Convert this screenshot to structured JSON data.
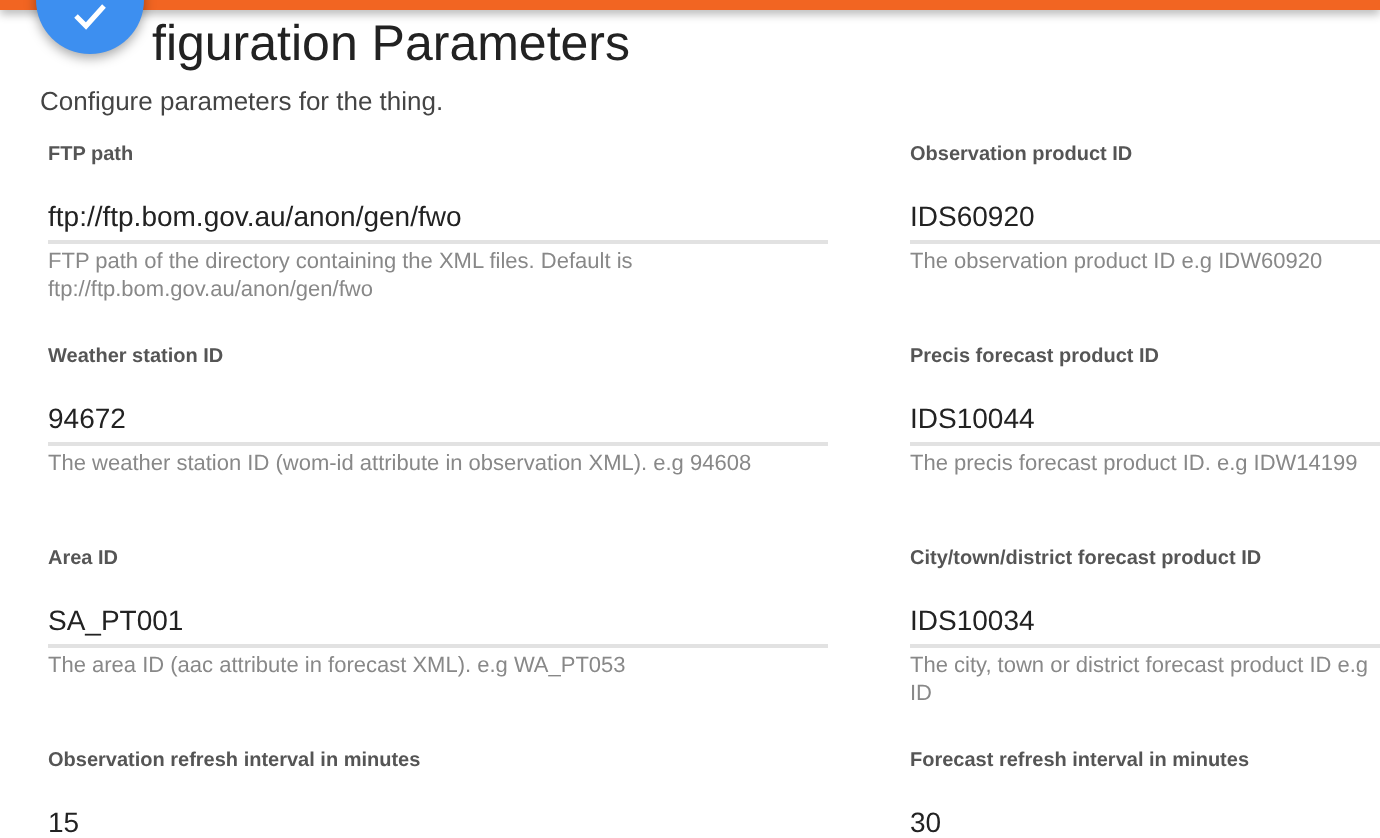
{
  "header": {
    "title": "figuration Parameters",
    "subtitle": "Configure parameters for the thing."
  },
  "fields": [
    {
      "label": "FTP path",
      "value": "ftp://ftp.bom.gov.au/anon/gen/fwo",
      "help": "FTP path of the directory containing the XML files. Default is ftp://ftp.bom.gov.au/anon/gen/fwo"
    },
    {
      "label": "Observation product ID",
      "value": "IDS60920",
      "help": "The observation product ID e.g IDW60920"
    },
    {
      "label": "Weather station ID",
      "value": "94672",
      "help": "The weather station ID (wom-id attribute in observation XML). e.g 94608"
    },
    {
      "label": "Precis forecast product ID",
      "value": "IDS10044",
      "help": "The precis forecast product ID. e.g IDW14199"
    },
    {
      "label": "Area ID",
      "value": "SA_PT001",
      "help": "The area ID (aac attribute in forecast XML). e.g WA_PT053"
    },
    {
      "label": "City/town/district forecast product ID",
      "value": "IDS10034",
      "help": "The city, town or district forecast product ID e.g ID"
    },
    {
      "label": "Observation refresh interval in minutes",
      "value": "15"
    },
    {
      "label": "Forecast refresh interval in minutes",
      "value": "30"
    }
  ]
}
